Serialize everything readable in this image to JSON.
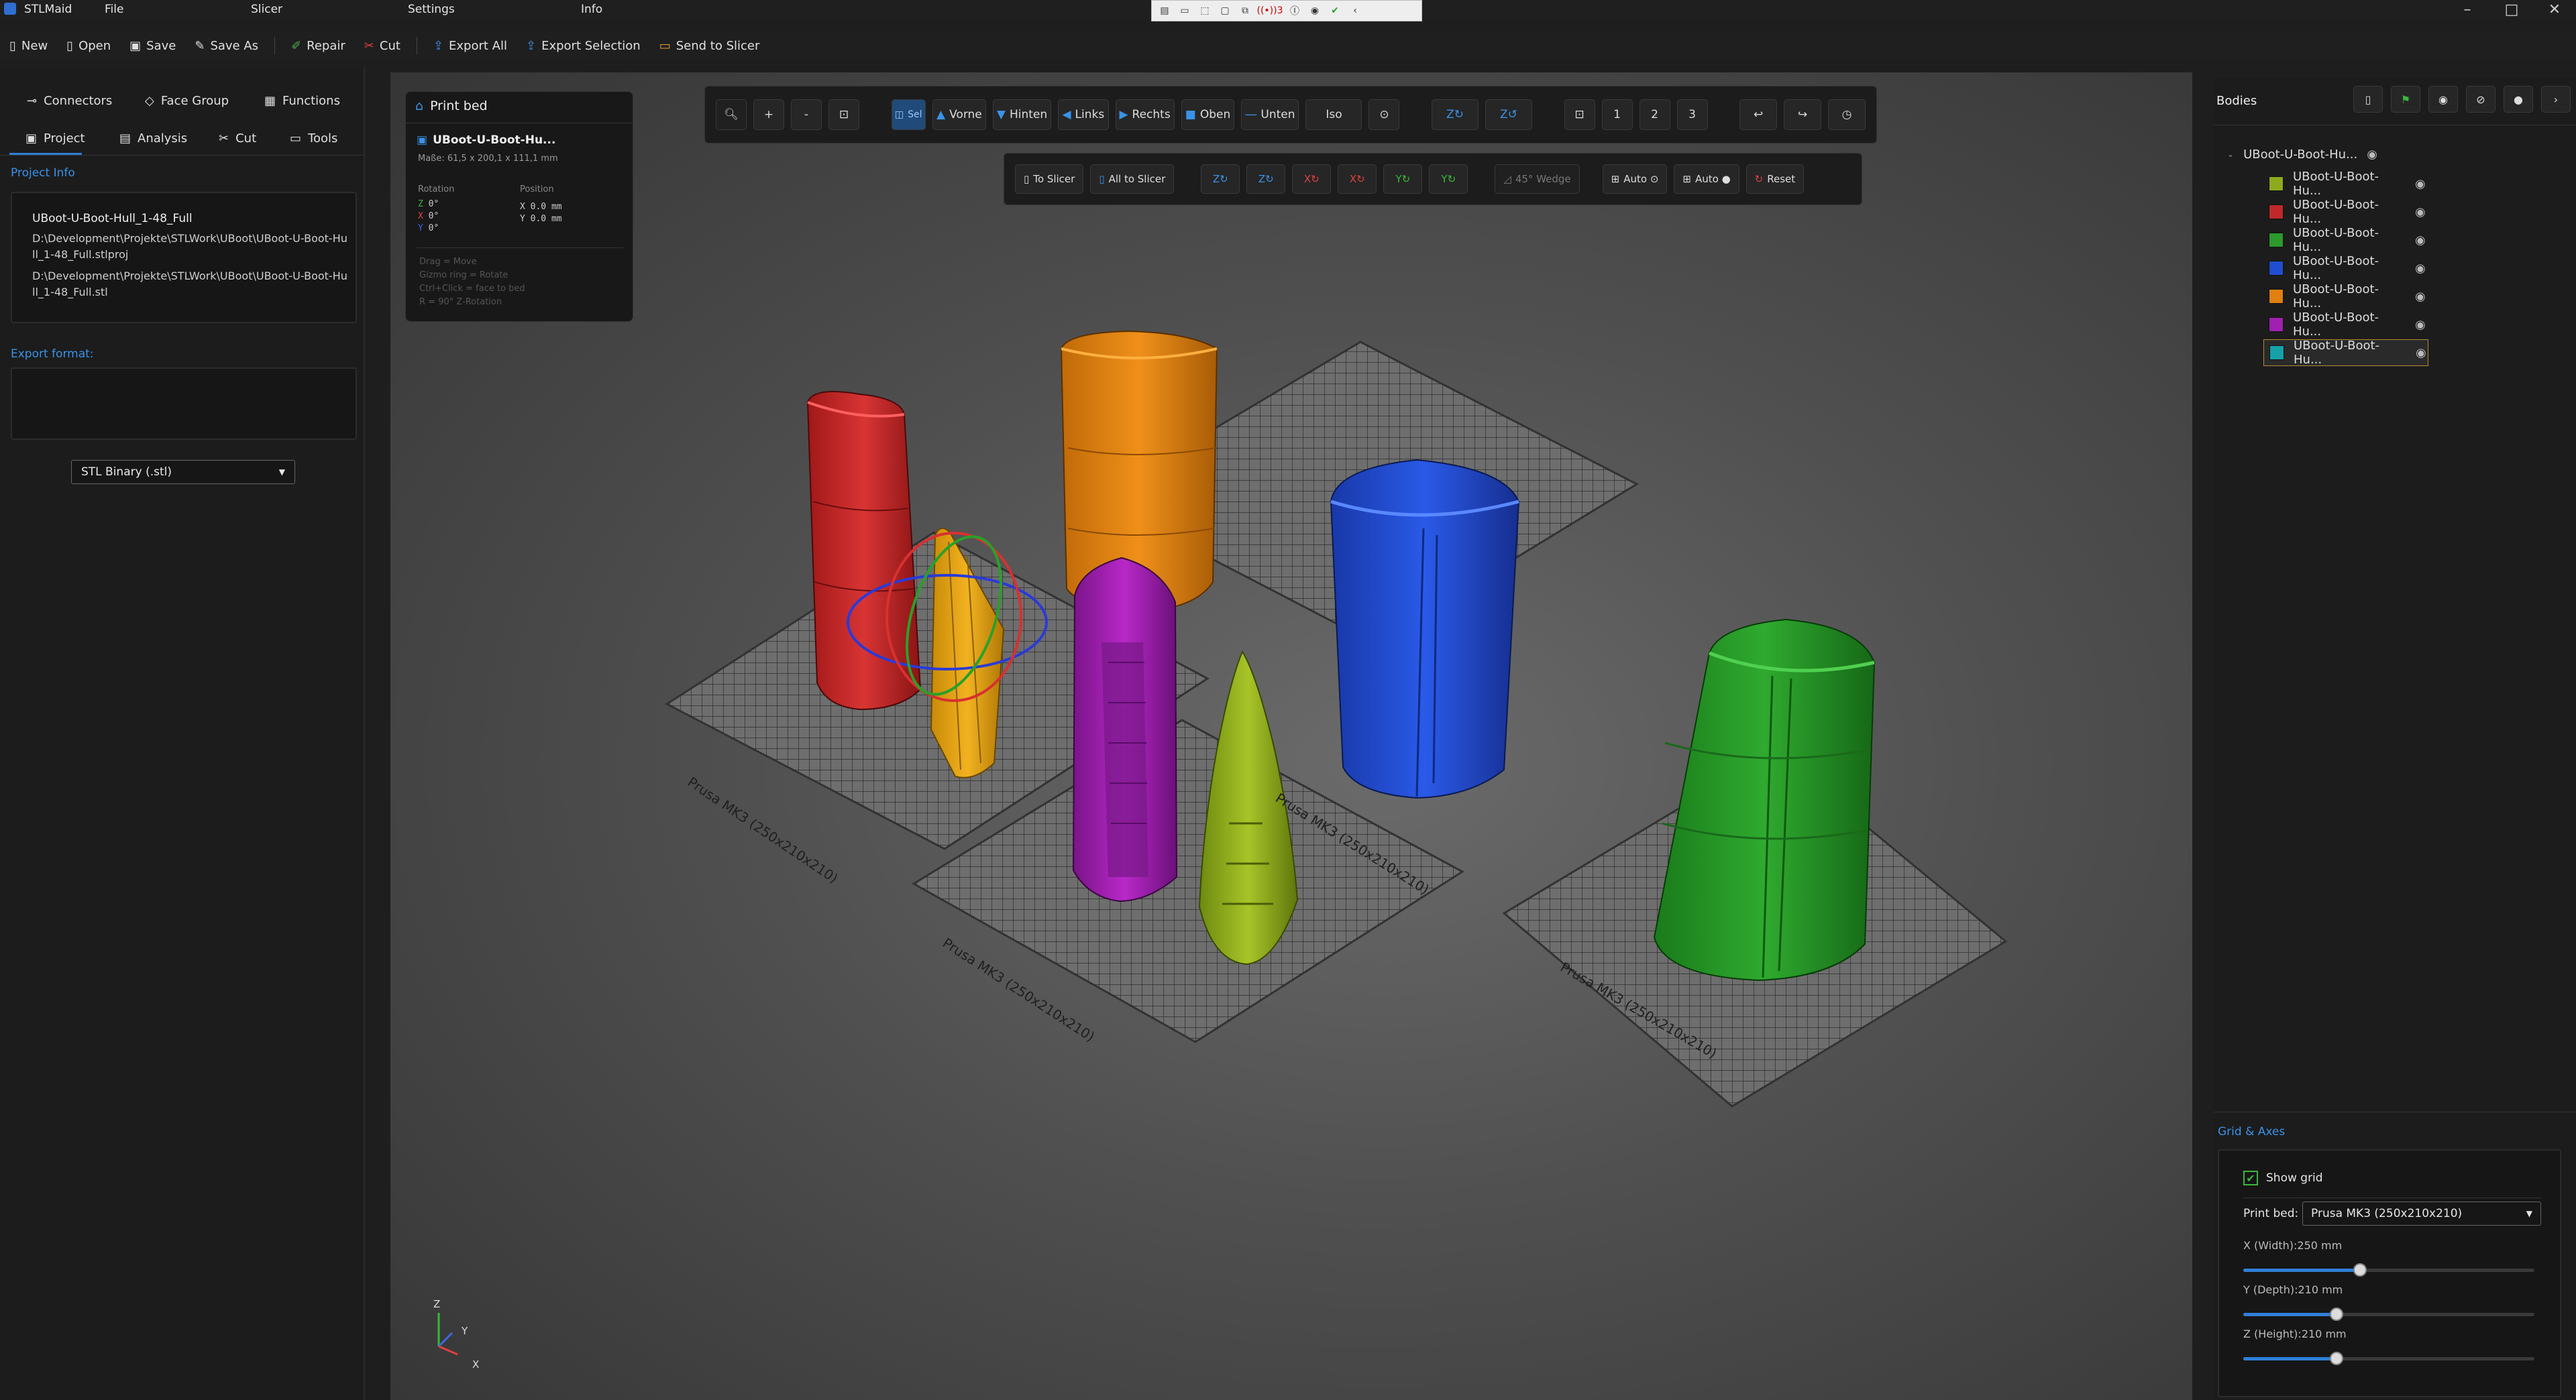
{
  "app": {
    "name": "STLMaid"
  },
  "menu": [
    {
      "label": "File"
    },
    {
      "label": "Slicer"
    },
    {
      "label": "Settings"
    },
    {
      "label": "Info"
    }
  ],
  "window_panel": {
    "badge": "3"
  },
  "toolbar": {
    "new": "New",
    "open": "Open",
    "save": "Save",
    "save_as": "Save As",
    "repair": "Repair",
    "cut": "Cut",
    "export_all": "Export All",
    "export_selection": "Export Selection",
    "send_to_slicer": "Send to Slicer"
  },
  "left_panel": {
    "row1": {
      "connectors": "Connectors",
      "face_group": "Face Group",
      "functions": "Functions"
    },
    "row2": {
      "project": "Project",
      "analysis": "Analysis",
      "cut": "Cut",
      "tools": "Tools"
    },
    "project_info_label": "Project Info",
    "project_name": "UBoot-U-Boot-Hull_1-48_Full",
    "project_path": "D:\\Development\\Projekte\\STLWork\\UBoot\\UBoot-U-Boot-Hull_1-48_Full.stlproj",
    "stl_path": "D:\\Development\\Projekte\\STLWork\\UBoot\\UBoot-U-Boot-Hull_1-48_Full.stl",
    "export_format_label": "Export format:",
    "export_format_value": "STL Binary (.stl)"
  },
  "print_bed_panel": {
    "title": "Print bed",
    "object_name": "UBoot-U-Boot-Hu...",
    "dims": "Maße: 61,5 x 200,1 x 111,1 mm",
    "rotation_label": "Rotation",
    "position_label": "Position",
    "rotation": {
      "z": "0°",
      "x": "0°",
      "y": "0°"
    },
    "position": {
      "x": "0.0 mm",
      "y": "0.0 mm"
    },
    "hints": [
      "Drag = Move",
      "Gizmo ring = Rotate",
      "Ctrl+Click = face to bed",
      "R = 90° Z-Rotation"
    ]
  },
  "view_toolbar": {
    "sel": "Sel",
    "vorne": "Vorne",
    "hinten": "Hinten",
    "links": "Links",
    "rechts": "Rechts",
    "oben": "Oben",
    "unten": "Unten",
    "iso": "Iso",
    "z_cw": "Z↻",
    "z_ccw": "Z↺",
    "cam1": "1",
    "cam2": "2",
    "cam3": "3"
  },
  "action_toolbar": {
    "to_slicer": "To Slicer",
    "all_to_slicer": "All to Slicer",
    "z1": "Z↻",
    "z2": "Z↻",
    "x1": "X↻",
    "x2": "X↻",
    "y1": "Y↻",
    "y2": "Y↻",
    "wedge": "45° Wedge",
    "auto1": "Auto ⊙",
    "auto2": "Auto ●",
    "reset": "Reset"
  },
  "bed_labels": [
    "Prusa MK3 (250x210x210)",
    "Prusa MK3 (250x210x210)",
    "Prusa MK3 (250x210x210)",
    "Prusa MK3 (250x210x210)"
  ],
  "axes": {
    "z": "Z",
    "y": "Y",
    "x": "X"
  },
  "bodies_panel": {
    "title": "Bodies",
    "root": "UBoot-U-Boot-Hu...",
    "items": [
      {
        "label": "UBoot-U-Boot-Hu...",
        "color": "#8eaa1e"
      },
      {
        "label": "UBoot-U-Boot-Hu...",
        "color": "#c0282a"
      },
      {
        "label": "UBoot-U-Boot-Hu...",
        "color": "#2c9a2c"
      },
      {
        "label": "UBoot-U-Boot-Hu...",
        "color": "#1f4fd0"
      },
      {
        "label": "UBoot-U-Boot-Hu...",
        "color": "#e08010"
      },
      {
        "label": "UBoot-U-Boot-Hu...",
        "color": "#a020b0"
      },
      {
        "label": "UBoot-U-Boot-Hu...",
        "color": "#16a0a8"
      }
    ]
  },
  "grid_axes": {
    "title": "Grid & Axes",
    "show_grid": "Show grid",
    "print_bed_label": "Print bed:",
    "print_bed_value": "Prusa MK3 (250x210x210)",
    "x_label": "X (Width):250 mm",
    "y_label": "Y (Depth):210 mm",
    "z_label": "Z (Height):210 mm",
    "x_level": 0.4,
    "y_level": 0.32,
    "z_level": 0.32
  }
}
